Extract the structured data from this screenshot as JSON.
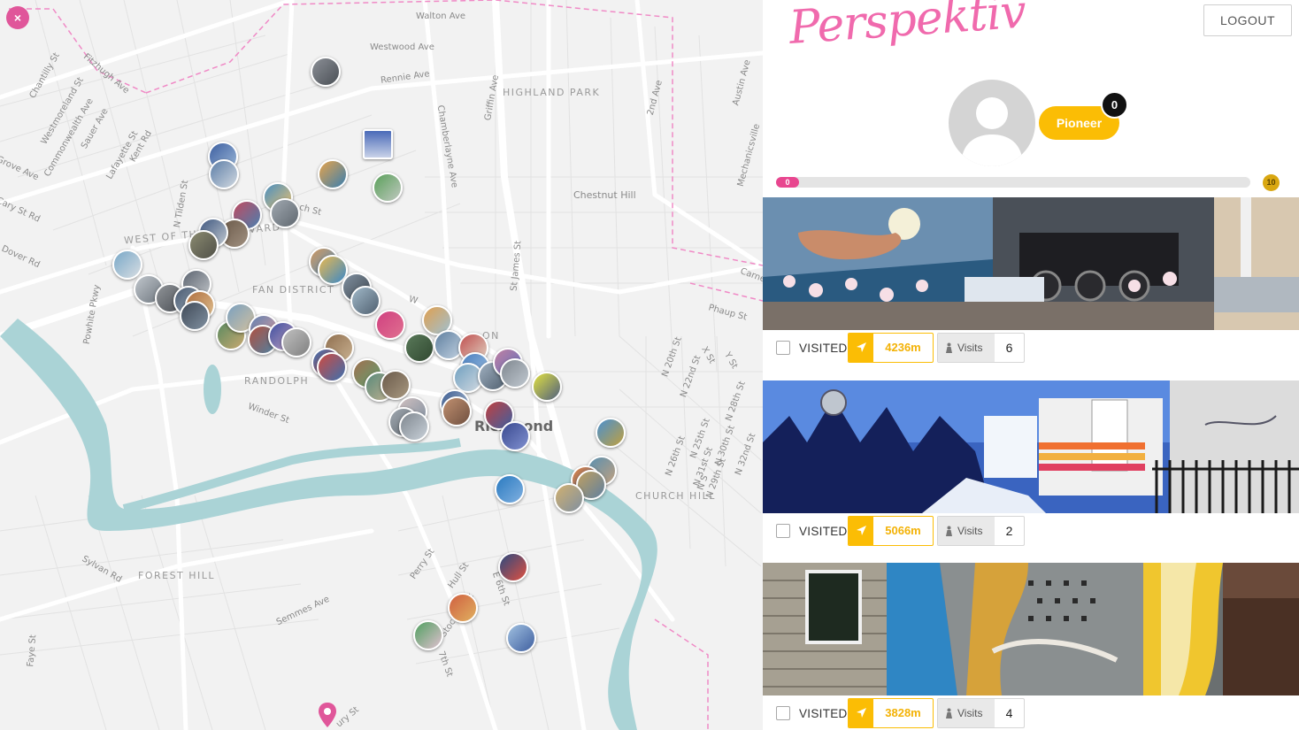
{
  "app": {
    "brand": "Perspektiv",
    "logout_label": "LOGOUT",
    "close_symbol": "×"
  },
  "user": {
    "rank_label": "Pioneer",
    "rank_count": "0",
    "progress_value": "0",
    "progress_max": "10"
  },
  "map": {
    "streets": [
      "Walton Ave",
      "Westwood Ave",
      "Rennie Ave",
      "Chantilly St",
      "Fitzhugh Ave",
      "Westmoreland St",
      "Commonwealth Ave",
      "Sauer Ave",
      "Lafayette St",
      "Kent Rd",
      "Grove Ave",
      "Cary St Rd",
      "Dover Rd",
      "N Tilden St",
      "Powhite Pkwy",
      "Griffin Ave",
      "Chamberlayne Ave",
      "2nd Ave",
      "Austin Ave",
      "Mechanicsville",
      "St James St",
      "Carne",
      "Phaup St",
      "Winder St",
      "X St",
      "Y St",
      "N 20th St",
      "N 22nd St",
      "N 28th St",
      "N 26th St",
      "N 25th St",
      "N 30th St",
      "N 32nd St",
      "N 31st St",
      "N 29th St",
      "Sylvan Rd",
      "Semmes Ave",
      "Perry St",
      "Hull St",
      "E 6th St",
      "Faye St",
      "Stockton St",
      "7th St",
      "ury St",
      "ch St",
      "W",
      "N S"
    ],
    "areas": [
      "HIGHLAND PARK",
      "WEST OF THE BOULEVARD",
      "FAN DISTRICT",
      "RANDOLPH",
      "CHURCH HILL",
      "FOREST HILL",
      "Chestnut Hill",
      "ON"
    ],
    "city": "Richmond"
  },
  "cards": [
    {
      "visited_label": "VISITED",
      "distance": "4236m",
      "visits_label": "Visits",
      "visits": "6"
    },
    {
      "visited_label": "VISITED",
      "distance": "5066m",
      "visits_label": "Visits",
      "visits": "2"
    },
    {
      "visited_label": "VISITED",
      "distance": "3828m",
      "visits_label": "Visits",
      "visits": "4"
    }
  ],
  "colors": {
    "brand_pink": "#f06aad",
    "accent_yellow": "#fbbd05",
    "progress_pink": "#e8468f",
    "river": "#aad3d6",
    "map_bg": "#f2f2f2"
  }
}
